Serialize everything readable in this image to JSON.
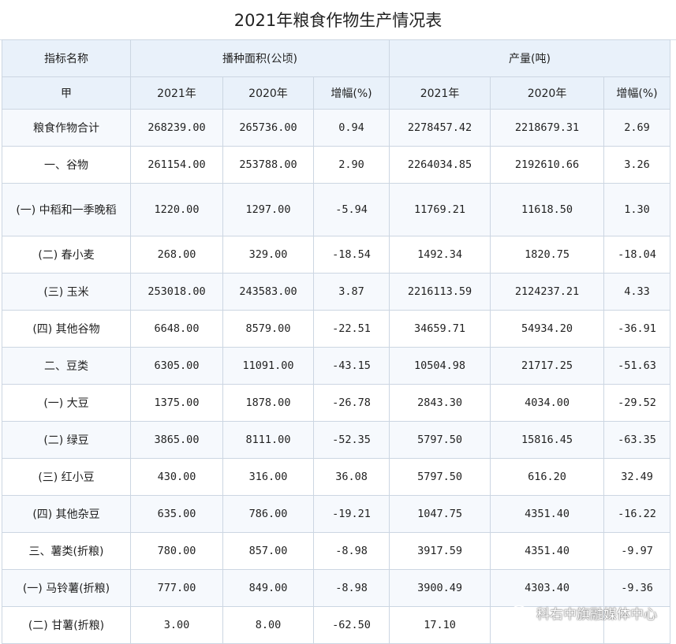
{
  "title": "2021年粮食作物生产情况表",
  "header": {
    "indicator": "指标名称",
    "area": "播种面积(公顷)",
    "output": "产量(吨)",
    "sub_first": "甲",
    "y2021": "2021年",
    "y2020": "2020年",
    "growth": "增幅(%)"
  },
  "rows": [
    {
      "name": "粮食作物合计",
      "a21": "268239.00",
      "a20": "265736.00",
      "ag": "0.94",
      "o21": "2278457.42",
      "o20": "2218679.31",
      "og": "2.69"
    },
    {
      "name": "一、谷物",
      "a21": "261154.00",
      "a20": "253788.00",
      "ag": "2.90",
      "o21": "2264034.85",
      "o20": "2192610.66",
      "og": "3.26"
    },
    {
      "name": "(一) 中稻和一季晚稻",
      "a21": "1220.00",
      "a20": "1297.00",
      "ag": "-5.94",
      "o21": "11769.21",
      "o20": "11618.50",
      "og": "1.30"
    },
    {
      "name": "(二) 春小麦",
      "a21": "268.00",
      "a20": "329.00",
      "ag": "-18.54",
      "o21": "1492.34",
      "o20": "1820.75",
      "og": "-18.04"
    },
    {
      "name": "(三) 玉米",
      "a21": "253018.00",
      "a20": "243583.00",
      "ag": "3.87",
      "o21": "2216113.59",
      "o20": "2124237.21",
      "og": "4.33"
    },
    {
      "name": "(四) 其他谷物",
      "a21": "6648.00",
      "a20": "8579.00",
      "ag": "-22.51",
      "o21": "34659.71",
      "o20": "54934.20",
      "og": "-36.91"
    },
    {
      "name": "二、豆类",
      "a21": "6305.00",
      "a20": "11091.00",
      "ag": "-43.15",
      "o21": "10504.98",
      "o20": "21717.25",
      "og": "-51.63"
    },
    {
      "name": "(一) 大豆",
      "a21": "1375.00",
      "a20": "1878.00",
      "ag": "-26.78",
      "o21": "2843.30",
      "o20": "4034.00",
      "og": "-29.52"
    },
    {
      "name": "(二) 绿豆",
      "a21": "3865.00",
      "a20": "8111.00",
      "ag": "-52.35",
      "o21": "5797.50",
      "o20": "15816.45",
      "og": "-63.35"
    },
    {
      "name": "(三) 红小豆",
      "a21": "430.00",
      "a20": "316.00",
      "ag": "36.08",
      "o21": "5797.50",
      "o20": "616.20",
      "og": "32.49"
    },
    {
      "name": "(四) 其他杂豆",
      "a21": "635.00",
      "a20": "786.00",
      "ag": "-19.21",
      "o21": "1047.75",
      "o20": "4351.40",
      "og": "-16.22"
    },
    {
      "name": "三、薯类(折粮)",
      "a21": "780.00",
      "a20": "857.00",
      "ag": "-8.98",
      "o21": "3917.59",
      "o20": "4351.40",
      "og": "-9.97"
    },
    {
      "name": "(一) 马铃薯(折粮)",
      "a21": "777.00",
      "a20": "849.00",
      "ag": "-8.98",
      "o21": "3900.49",
      "o20": "4303.40",
      "og": "-9.36"
    },
    {
      "name": "(二) 甘薯(折粮)",
      "a21": "3.00",
      "a20": "8.00",
      "ag": "-62.50",
      "o21": "17.10",
      "o20": "",
      "og": ""
    }
  ],
  "watermark": "科右中旗融媒体中心",
  "watermark_icon": "wechat-icon"
}
